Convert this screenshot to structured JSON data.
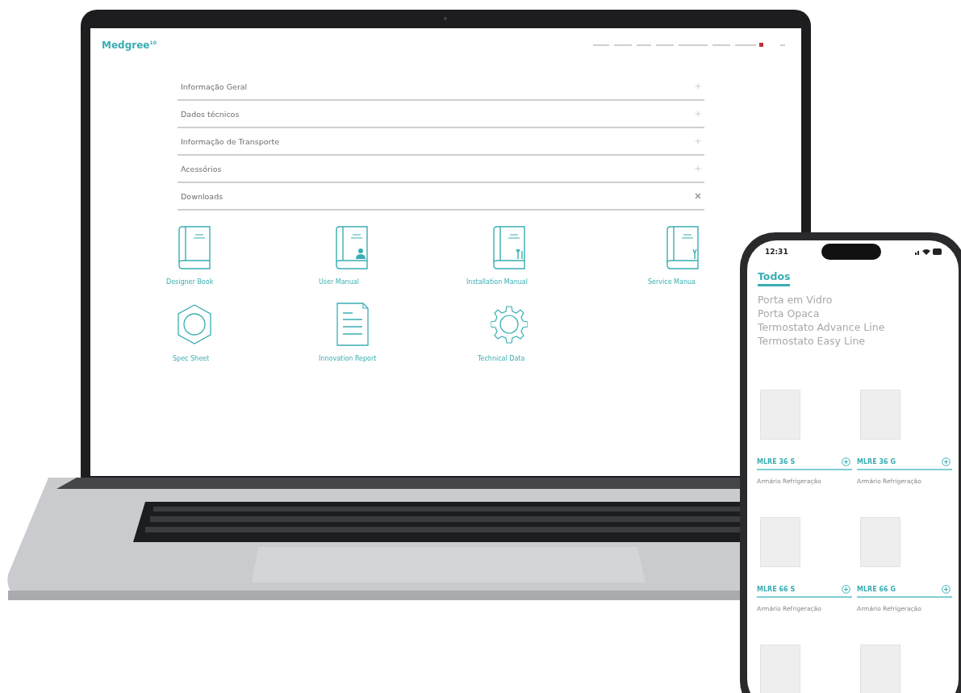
{
  "laptop": {
    "logo": "Medgree",
    "logo_mark": "10",
    "accordion": [
      {
        "label": "Informação Geral",
        "expanded": false
      },
      {
        "label": "Dados técnicos",
        "expanded": false
      },
      {
        "label": "Informação de Transporte",
        "expanded": false
      },
      {
        "label": "Acessórios",
        "expanded": false
      },
      {
        "label": "Downloads",
        "expanded": true
      }
    ],
    "downloads": [
      {
        "label": "Designer Book",
        "kind": "book"
      },
      {
        "label": "User Manual",
        "kind": "user"
      },
      {
        "label": "Installation Manual",
        "kind": "tools"
      },
      {
        "label": "Service Manua",
        "kind": "wrench"
      },
      {
        "label": "Spec Sheet",
        "kind": "nut"
      },
      {
        "label": "Innovation Report",
        "kind": "document"
      },
      {
        "label": "Technical Data",
        "kind": "gear"
      }
    ]
  },
  "phone": {
    "time": "12:31",
    "tabs": [
      {
        "label": "Todos",
        "selected": true
      },
      {
        "label": "Porta em Vidro",
        "selected": false
      },
      {
        "label": "Porta Opaca",
        "selected": false
      },
      {
        "label": "Termostato Advance Line",
        "selected": false
      },
      {
        "label": "Termostato Easy Line",
        "selected": false
      }
    ],
    "products": [
      {
        "name": "MLRE 36 S",
        "category": "Armário Refrigeração"
      },
      {
        "name": "MLRE 36 G",
        "category": "Armário Refrigeração"
      },
      {
        "name": "MLRE 66 S",
        "category": "Armário Refrigeração"
      },
      {
        "name": "MLRE 66 G",
        "category": "Armário Refrigeração"
      }
    ]
  }
}
